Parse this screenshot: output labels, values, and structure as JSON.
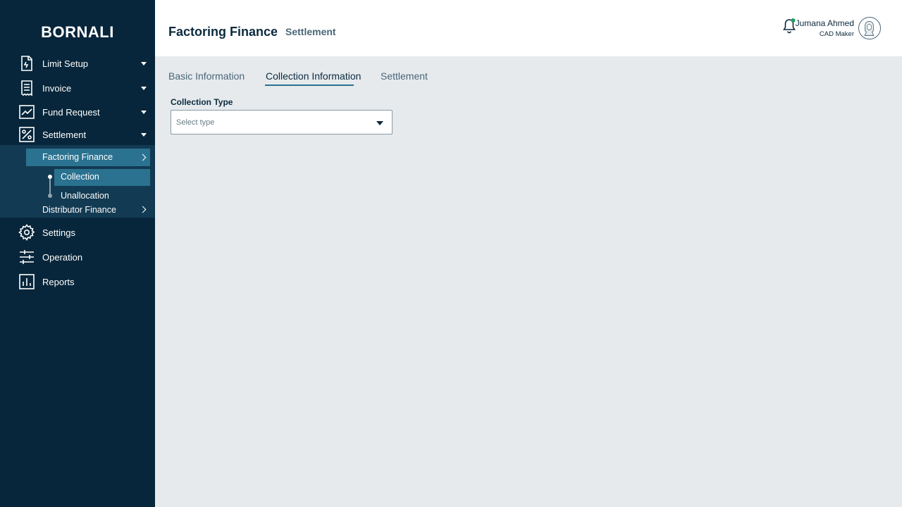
{
  "brand": "BORNALI",
  "sidebar": {
    "items": [
      {
        "label": "Limit Setup",
        "icon": "document-icon"
      },
      {
        "label": "Invoice",
        "icon": "receipt-icon"
      },
      {
        "label": "Fund Request",
        "icon": "trend-chart-icon"
      },
      {
        "label": "Settlement",
        "icon": "percent-icon"
      },
      {
        "label": "Settings",
        "icon": "gear-icon"
      },
      {
        "label": "Operation",
        "icon": "sliders-icon"
      },
      {
        "label": "Reports",
        "icon": "bar-chart-icon"
      }
    ],
    "settlement_sub": {
      "factoring": "Factoring Finance",
      "collection": "Collection",
      "unallocation": "Unallocation",
      "distributor": "Distributor Finance"
    }
  },
  "header": {
    "title": "Factoring Finance",
    "subtitle": "Settlement",
    "user_name": "Jumana Ahmed",
    "user_role": "CAD Maker"
  },
  "tabs": [
    {
      "label": "Basic Information",
      "active": false
    },
    {
      "label": "Collection Information",
      "active": true
    },
    {
      "label": "Settlement",
      "active": false
    }
  ],
  "form": {
    "collection_type_label": "Collection Type",
    "collection_type_placeholder": "Select type"
  },
  "colors": {
    "sidebar_bg": "#07263b",
    "active_bg": "#2a7290",
    "notification_dot": "#1e9e5a",
    "content_bg": "#e6eaed"
  }
}
